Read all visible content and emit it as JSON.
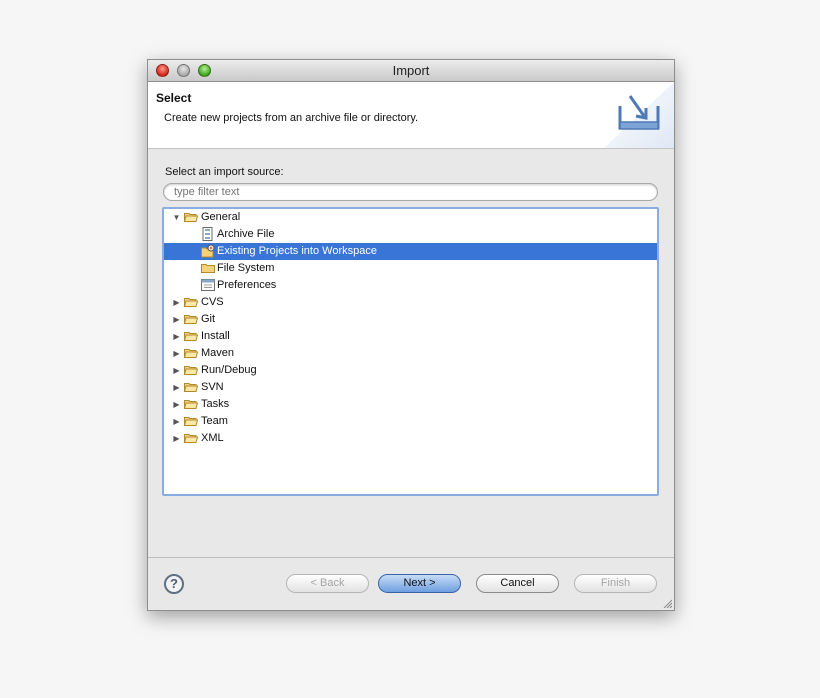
{
  "window": {
    "title": "Import"
  },
  "header": {
    "title": "Select",
    "description": "Create new projects from an archive file or directory."
  },
  "source": {
    "label": "Select an import source:",
    "filter_placeholder": "type filter text",
    "tree": [
      {
        "label": "General",
        "expanded": true,
        "level": 0,
        "icon": "folder-open-icon"
      },
      {
        "label": "Archive File",
        "level": 1,
        "icon": "archive-file-icon"
      },
      {
        "label": "Existing Projects into Workspace",
        "level": 1,
        "icon": "existing-projects-icon",
        "selected": true
      },
      {
        "label": "File System",
        "level": 1,
        "icon": "folder-icon"
      },
      {
        "label": "Preferences",
        "level": 1,
        "icon": "preferences-icon"
      },
      {
        "label": "CVS",
        "level": 0,
        "icon": "folder-icon"
      },
      {
        "label": "Git",
        "level": 0,
        "icon": "folder-icon"
      },
      {
        "label": "Install",
        "level": 0,
        "icon": "folder-icon"
      },
      {
        "label": "Maven",
        "level": 0,
        "icon": "folder-icon"
      },
      {
        "label": "Run/Debug",
        "level": 0,
        "icon": "folder-icon"
      },
      {
        "label": "SVN",
        "level": 0,
        "icon": "folder-icon"
      },
      {
        "label": "Tasks",
        "level": 0,
        "icon": "folder-icon"
      },
      {
        "label": "Team",
        "level": 0,
        "icon": "folder-icon"
      },
      {
        "label": "XML",
        "level": 0,
        "icon": "folder-icon"
      }
    ]
  },
  "buttons": {
    "help": "?",
    "back": "< Back",
    "next": "Next >",
    "cancel": "Cancel",
    "finish": "Finish"
  },
  "colors": {
    "selection": "#3875d7",
    "tree_border": "#86aee0",
    "default_button": "#6f9fe1"
  }
}
